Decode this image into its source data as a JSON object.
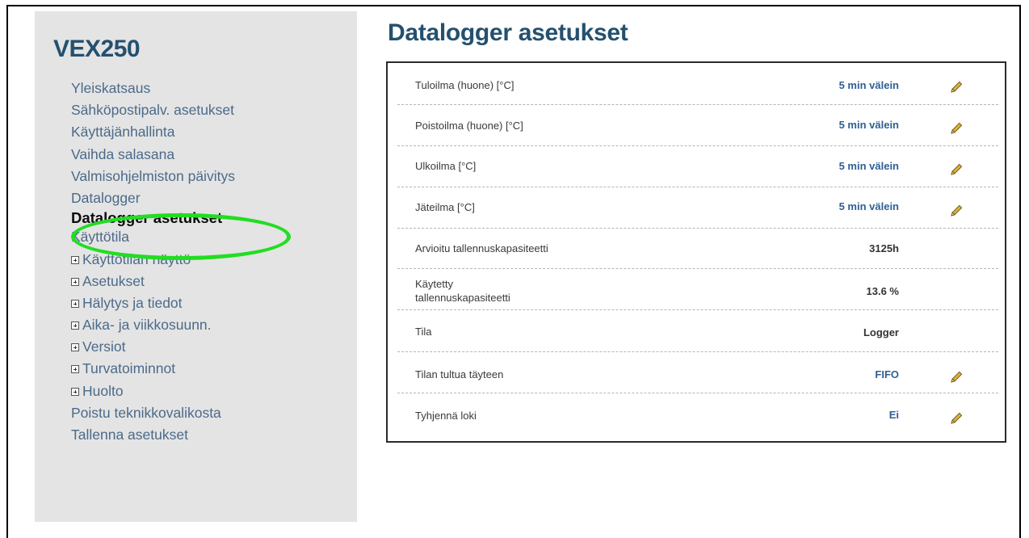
{
  "sidebar": {
    "brand": "VEX250",
    "items": [
      {
        "label": "Yleiskatsaus"
      },
      {
        "label": "Sähköpostipalv. asetukset"
      },
      {
        "label": "Käyttäjänhallinta"
      },
      {
        "label": "Vaihda salasana"
      },
      {
        "label": "Valmisohjelmiston päivitys"
      },
      {
        "label": "Datalogger"
      },
      {
        "label": "Datalogger asetukset"
      },
      {
        "label": "Käyttötila"
      },
      {
        "label": "Käyttötilan näyttö"
      },
      {
        "label": "Asetukset"
      },
      {
        "label": "Hälytys ja tiedot"
      },
      {
        "label": "Aika- ja viikkosuunn."
      },
      {
        "label": "Versiot"
      },
      {
        "label": "Turvatoiminnot"
      },
      {
        "label": "Huolto"
      },
      {
        "label": "Poistu teknikkovalikosta"
      },
      {
        "label": "Tallenna asetukset"
      }
    ],
    "highlight_color": "#22dd22"
  },
  "main": {
    "title": "Datalogger asetukset",
    "rows": [
      {
        "label": "Tuloilma (huone) [°C]",
        "value": "5 min välein",
        "editable": true
      },
      {
        "label": "Poistoilma (huone) [°C]",
        "value": "5 min välein",
        "editable": true
      },
      {
        "label": "Ulkoilma [°C]",
        "value": "5 min välein",
        "editable": true
      },
      {
        "label": "Jäteilma [°C]",
        "value": "5 min välein",
        "editable": true
      },
      {
        "label": "Arvioitu tallennuskapasiteetti",
        "value": "3125h",
        "editable": false
      },
      {
        "label": "Käytetty tallennuskapasiteetti",
        "value": "13.6 %",
        "editable": false
      },
      {
        "label": "Tila",
        "value": "Logger",
        "editable": false
      },
      {
        "label": "Tilan tultua täyteen",
        "value": "FIFO",
        "editable": true
      },
      {
        "label": "Tyhjennä loki",
        "value": "Ei",
        "editable": true
      }
    ]
  },
  "icons": {
    "edit": "pencil-icon",
    "expand": "plus-box-icon"
  },
  "colors": {
    "title": "#25506f",
    "link": "#4b6a8a",
    "value": "#2f5f95",
    "pencil": "#d9b43a"
  }
}
